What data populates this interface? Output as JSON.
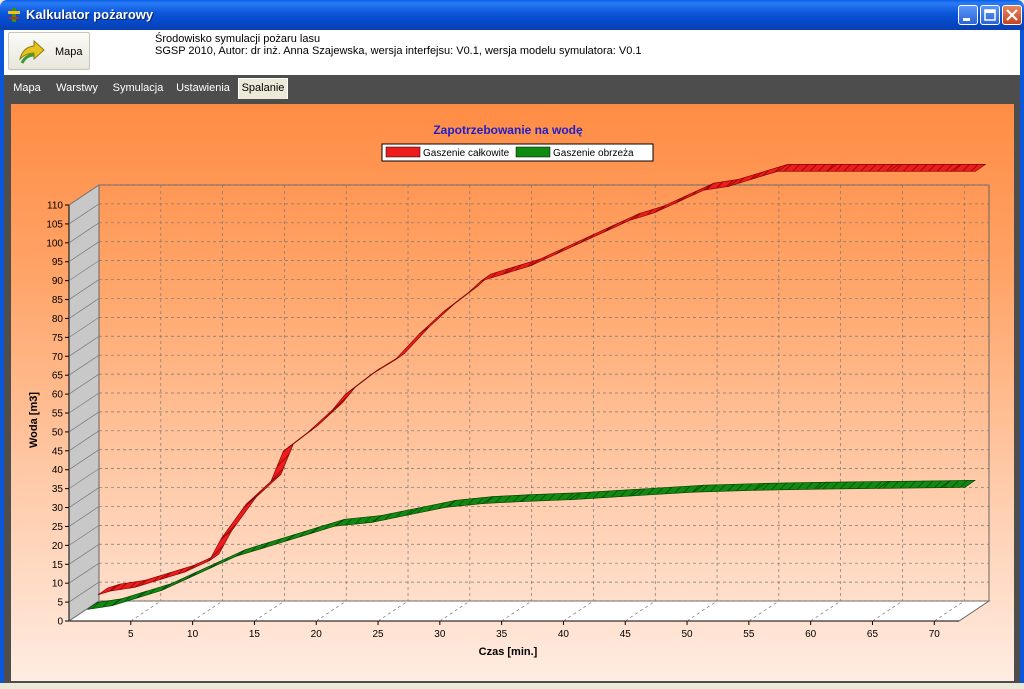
{
  "window": {
    "title": "Kalkulator pożarowy"
  },
  "toolbar": {
    "map_button_label": "Mapa"
  },
  "info": {
    "line1": "Środowisko symulacji pożaru lasu",
    "line2": "SGSP 2010, Autor: dr inż. Anna Szajewska, wersja interfejsu: V0.1, wersja modelu symulatora: V0.1"
  },
  "tabs": [
    {
      "label": "Mapa",
      "active": false
    },
    {
      "label": "Warstwy",
      "active": false
    },
    {
      "label": "Symulacja",
      "active": false
    },
    {
      "label": "Ustawienia",
      "active": false
    },
    {
      "label": "Spalanie",
      "active": true
    }
  ],
  "colors": {
    "title_bar": "#0a55d8",
    "series_total": "#ee1c1c",
    "series_perimeter": "#118a11",
    "chart_title": "#2020c8"
  },
  "chart_data": {
    "type": "line",
    "title": "Zapotrzebowanie na wodę",
    "xlabel": "Czas [min.]",
    "ylabel": "Woda [m3]",
    "xlim": [
      0,
      72
    ],
    "ylim": [
      0,
      110
    ],
    "x_ticks": [
      "5",
      "10",
      "15",
      "20",
      "25",
      "30",
      "35",
      "40",
      "45",
      "50",
      "55",
      "60",
      "65",
      "70"
    ],
    "y_ticks": [
      "0",
      "5",
      "10",
      "15",
      "20",
      "25",
      "30",
      "35",
      "40",
      "45",
      "50",
      "55",
      "60",
      "65",
      "70",
      "75",
      "80",
      "85",
      "90",
      "95",
      "100",
      "105",
      "110"
    ],
    "grid": true,
    "legend_position": "top-center",
    "series": [
      {
        "name": "Gaszenie całkowite",
        "x": [
          1,
          2,
          4,
          6,
          8,
          10,
          11,
          13,
          15,
          16,
          18,
          20,
          21,
          23,
          25,
          27,
          29,
          31,
          32,
          34,
          36,
          38,
          40,
          42,
          44,
          46,
          48,
          50,
          52,
          54,
          56,
          60,
          65,
          70,
          72
        ],
        "y": [
          4,
          5,
          6,
          8,
          10,
          13,
          19,
          28,
          34,
          42,
          47,
          53,
          57,
          62,
          66,
          73,
          79,
          84,
          87,
          89,
          91,
          94,
          97,
          100,
          103,
          105,
          108,
          111,
          112,
          114,
          116,
          116,
          116,
          116,
          116
        ]
      },
      {
        "name": "Gaszenie obrzeża",
        "x": [
          1,
          3,
          5,
          7,
          9,
          11,
          13,
          15,
          17,
          19,
          21,
          24,
          27,
          30,
          33,
          36,
          40,
          45,
          50,
          55,
          60,
          65,
          70,
          72
        ],
        "y": [
          2,
          3,
          5,
          7,
          10,
          13,
          16,
          18,
          20,
          22,
          24,
          25,
          27,
          29,
          30,
          30.5,
          31,
          32,
          33,
          33.5,
          33.8,
          34,
          34.2,
          34.3
        ]
      }
    ]
  }
}
